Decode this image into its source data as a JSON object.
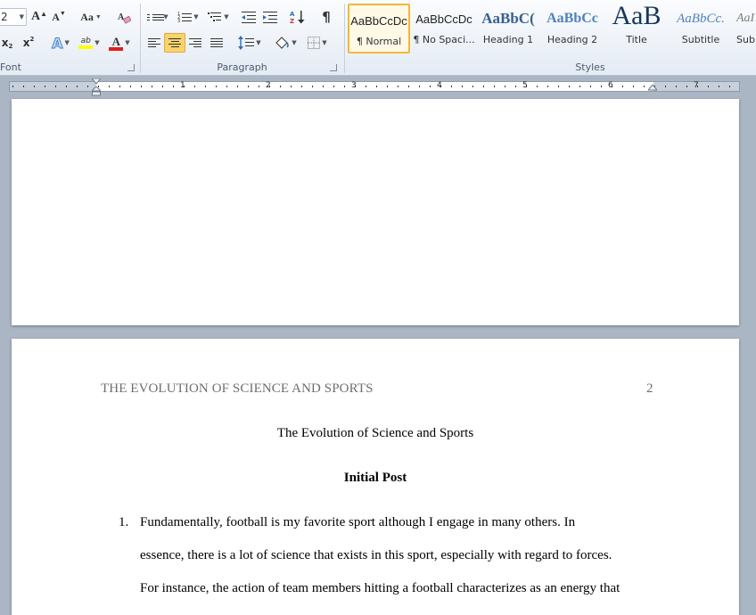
{
  "ribbon": {
    "font": {
      "label": "Font",
      "size_value": "2",
      "grow_label": "A",
      "shrink_label": "A",
      "case_label": "Aa",
      "subscript_label": "x",
      "superscript_label": "x",
      "text_effects_label": "A",
      "highlight_label": "ab",
      "font_color_label": "A"
    },
    "paragraph": {
      "label": "Paragraph",
      "sort_label": "A↓",
      "show_marks_label": "¶"
    },
    "styles": {
      "label": "Styles",
      "items": [
        {
          "preview": "AaBbCcDc",
          "name": "¶ Normal"
        },
        {
          "preview": "AaBbCcDc",
          "name": "¶ No Spaci..."
        },
        {
          "preview": "AaBbC(",
          "name": "Heading 1"
        },
        {
          "preview": "AaBbCc",
          "name": "Heading 2"
        },
        {
          "preview": "AaB",
          "name": "Title"
        },
        {
          "preview": "AaBbCc.",
          "name": "Subtitle"
        },
        {
          "preview": "AaI",
          "name": "Sub"
        }
      ]
    }
  },
  "ruler": {
    "numbers": [
      "1",
      "2",
      "3",
      "4",
      "5",
      "6",
      "7"
    ]
  },
  "document": {
    "header_title": "THE EVOLUTION OF SCIENCE AND SPORTS",
    "page_number": "2",
    "title": "The Evolution of Science and Sports",
    "subtitle": "Initial Post",
    "list_number": "1.",
    "paragraph_lines": [
      "Fundamentally, football is my favorite sport although I engage in many others. In",
      "essence, there is a lot of science that exists in this sport, especially with regard to forces.",
      "For instance, the action of team members hitting a football characterizes as an energy that"
    ]
  },
  "colors": {
    "ribbon_bg": "#e4ebf4",
    "workspace_bg": "#abb6c4",
    "active_button": "#fbd36b",
    "heading_blue": "#17365d",
    "header_gray": "#6e6e6e"
  }
}
